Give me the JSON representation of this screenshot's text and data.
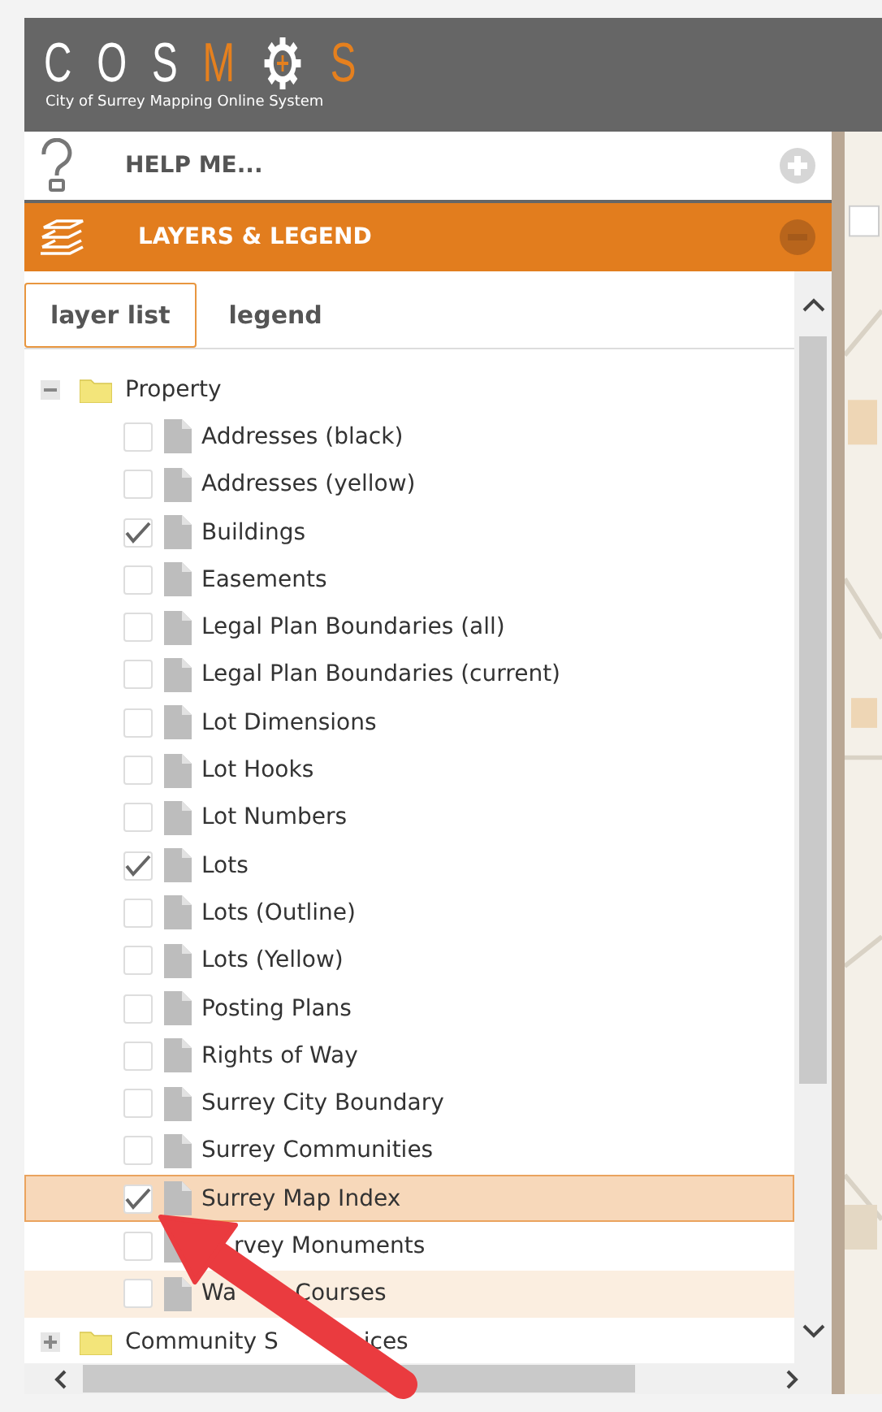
{
  "header": {
    "logo": {
      "letters": "COS",
      "accent_letter": "M",
      "last_letter": "S"
    },
    "subtitle": "City of Surrey Mapping Online System"
  },
  "panels": [
    {
      "kind": "help",
      "title": "HELP ME...",
      "expanded": false
    },
    {
      "kind": "layers",
      "title": "LAYERS & LEGEND",
      "expanded": true
    }
  ],
  "tabs": [
    {
      "label": "layer list",
      "selected": true
    },
    {
      "label": "legend",
      "selected": false
    }
  ],
  "tree": [
    {
      "label": "Property",
      "expanded": true,
      "children": [
        {
          "label": "Addresses (black)",
          "checked": false,
          "selected": false,
          "hovered": false
        },
        {
          "label": "Addresses (yellow)",
          "checked": false,
          "selected": false,
          "hovered": false
        },
        {
          "label": "Buildings",
          "checked": true,
          "selected": false,
          "hovered": false
        },
        {
          "label": "Easements",
          "checked": false,
          "selected": false,
          "hovered": false
        },
        {
          "label": "Legal Plan Boundaries (all)",
          "checked": false,
          "selected": false,
          "hovered": false
        },
        {
          "label": "Legal Plan Boundaries (current)",
          "checked": false,
          "selected": false,
          "hovered": false
        },
        {
          "label": "Lot Dimensions",
          "checked": false,
          "selected": false,
          "hovered": false
        },
        {
          "label": "Lot Hooks",
          "checked": false,
          "selected": false,
          "hovered": false
        },
        {
          "label": "Lot Numbers",
          "checked": false,
          "selected": false,
          "hovered": false
        },
        {
          "label": "Lots",
          "checked": true,
          "selected": false,
          "hovered": false
        },
        {
          "label": "Lots (Outline)",
          "checked": false,
          "selected": false,
          "hovered": false
        },
        {
          "label": "Lots (Yellow)",
          "checked": false,
          "selected": false,
          "hovered": false
        },
        {
          "label": "Posting Plans",
          "checked": false,
          "selected": false,
          "hovered": false
        },
        {
          "label": "Rights of Way",
          "checked": false,
          "selected": false,
          "hovered": false
        },
        {
          "label": "Surrey City Boundary",
          "checked": false,
          "selected": false,
          "hovered": false
        },
        {
          "label": "Surrey Communities",
          "checked": false,
          "selected": false,
          "hovered": false
        },
        {
          "label": "Surrey Map Index",
          "checked": true,
          "selected": true,
          "hovered": false
        },
        {
          "label_parts": [
            "rvey Monuments"
          ],
          "covered_start": true,
          "checked": false,
          "selected": false,
          "hovered": false
        },
        {
          "label_parts": [
            "Wa",
            "Courses"
          ],
          "covered_start": false,
          "checked": false,
          "selected": false,
          "hovered": true
        }
      ]
    },
    {
      "label_parts": [
        "Community S",
        "ices"
      ],
      "expanded": false
    }
  ]
}
